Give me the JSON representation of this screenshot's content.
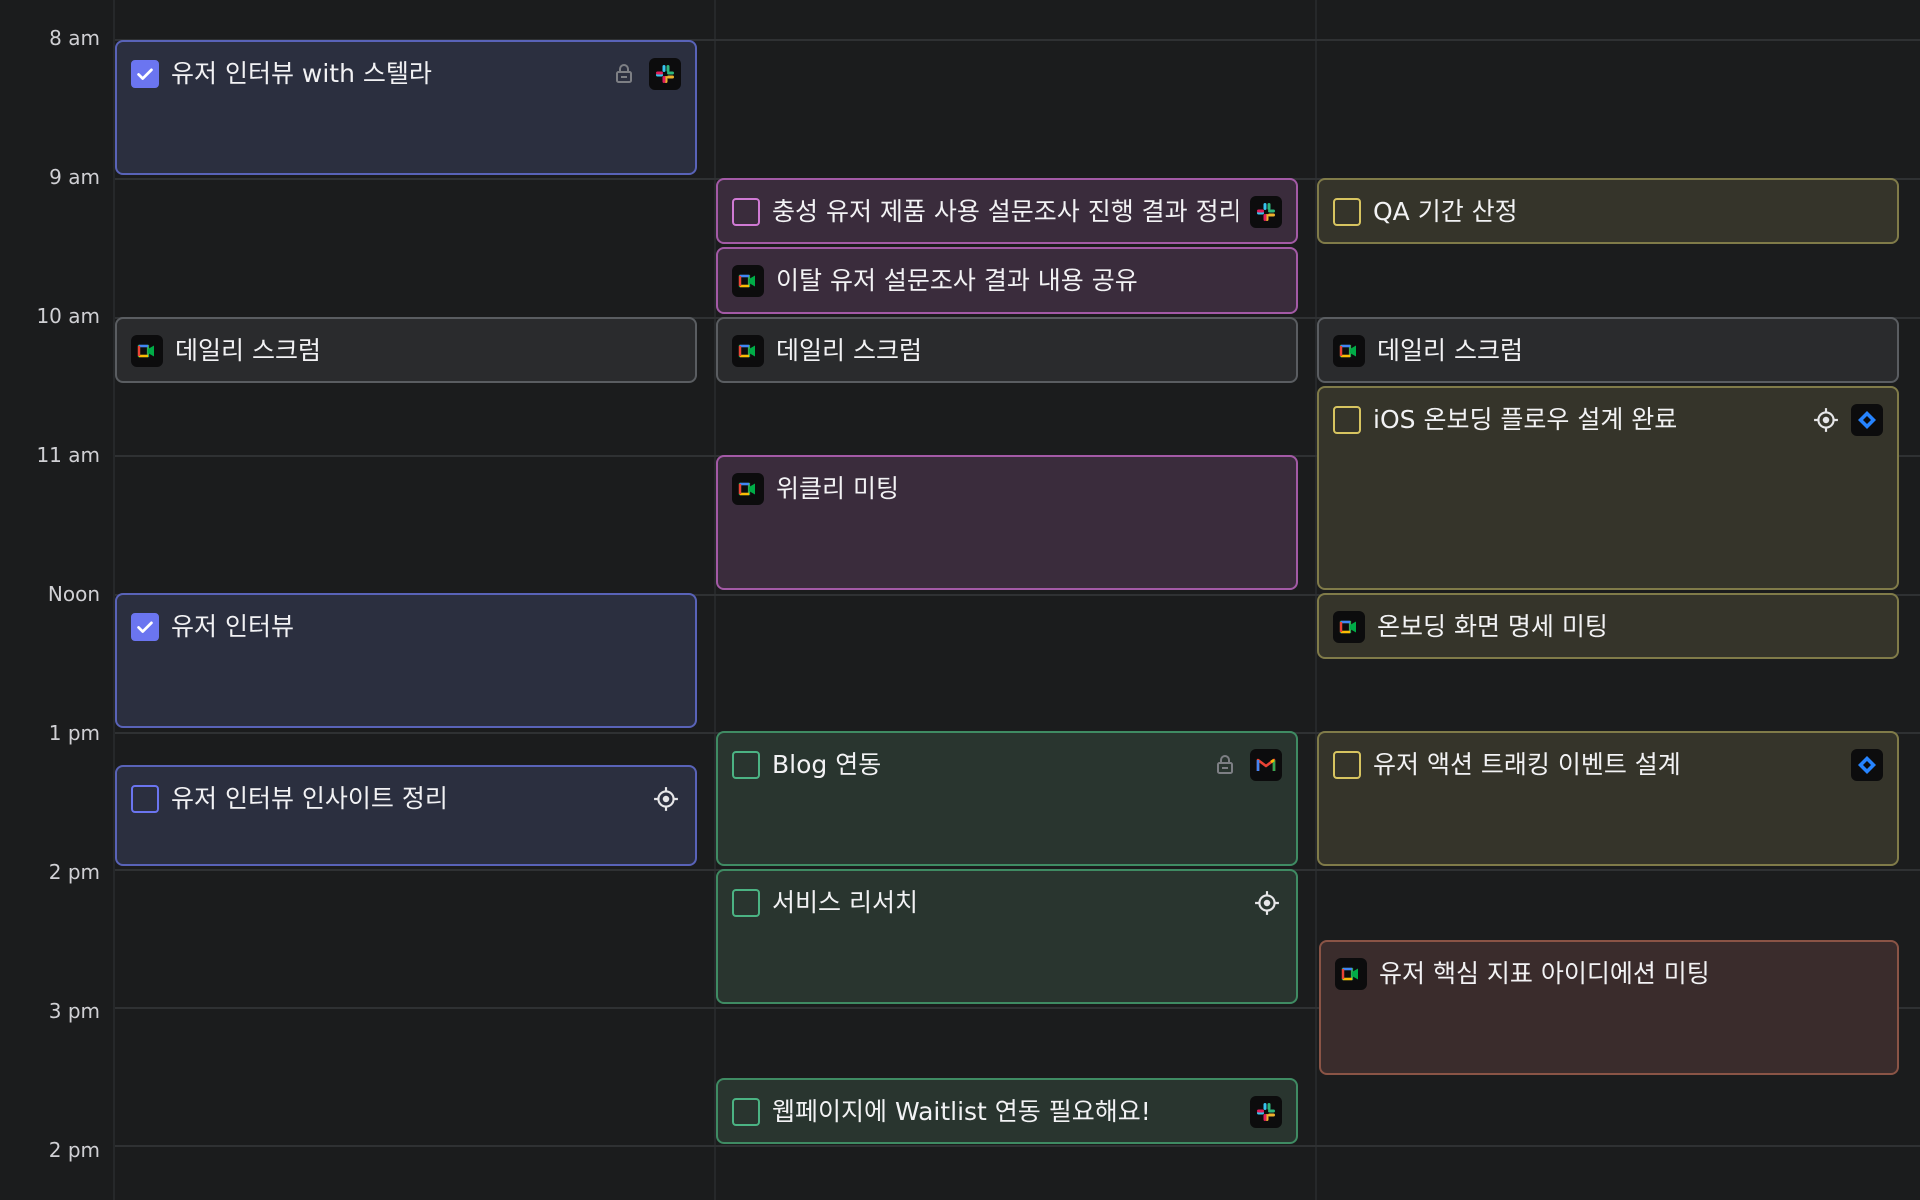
{
  "time_labels": [
    "8 am",
    "9 am",
    "10 am",
    "11 am",
    "Noon",
    "1 pm",
    "2 pm",
    "3 pm",
    "2 pm"
  ],
  "events": {
    "e1": {
      "title": "유저 인터뷰 with 스텔라"
    },
    "e2": {
      "title": "데일리 스크럼"
    },
    "e3": {
      "title": "유저 인터뷰"
    },
    "e4": {
      "title": "유저 인터뷰 인사이트 정리"
    },
    "e5": {
      "title": "충성 유저 제품 사용 설문조사 진행 결과 정리"
    },
    "e6": {
      "title": "이탈 유저 설문조사 결과 내용 공유"
    },
    "e7": {
      "title": "데일리 스크럼"
    },
    "e8": {
      "title": "위클리 미팅"
    },
    "e9": {
      "title": "Blog 연동"
    },
    "e10": {
      "title": "서비스 리서치"
    },
    "e11": {
      "title": "웹페이지에 Waitlist 연동 필요해요!"
    },
    "e12": {
      "title": "QA 기간 산정"
    },
    "e13": {
      "title": "데일리 스크럼"
    },
    "e14": {
      "title": "iOS 온보딩 플로우 설계 완료"
    },
    "e15": {
      "title": "온보딩 화면 명세 미팅"
    },
    "e16": {
      "title": "유저 액션 트래킹 이벤트 설계"
    },
    "e17": {
      "title": "유저 핵심 지표 아이디에션 미팅"
    }
  },
  "colors": {
    "background": "#1b1c1d",
    "task_blue": "#6b75f0",
    "task_pink": "#d07ad4",
    "task_yellow": "#d7c460",
    "task_green": "#4bb383",
    "jira": "#2684ff"
  }
}
